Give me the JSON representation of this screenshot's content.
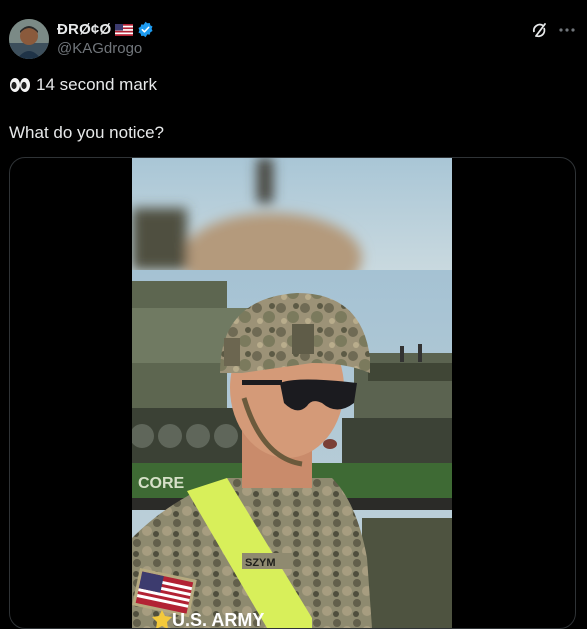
{
  "post": {
    "display_name": "ĐRØ¢Ø",
    "handle": "@KAGdrogo",
    "line1": "14 second mark",
    "line2": "What do you notice?",
    "icons": {
      "avatar": "avatar",
      "flag": "us-flag-icon",
      "verified": "verified-badge-icon",
      "grok": "grok-icon",
      "more": "more-icon",
      "eyes": "eyes-emoji-icon"
    },
    "media": {
      "type": "video",
      "caption_text": "U.S. ARMY",
      "nametape": "SZYM",
      "railcar_text": "CORE"
    }
  },
  "colors": {
    "background": "#000000",
    "text": "#e7e9ea",
    "secondary_text": "#71767b",
    "verified": "#1d9bf0",
    "border": "#2f3336"
  }
}
